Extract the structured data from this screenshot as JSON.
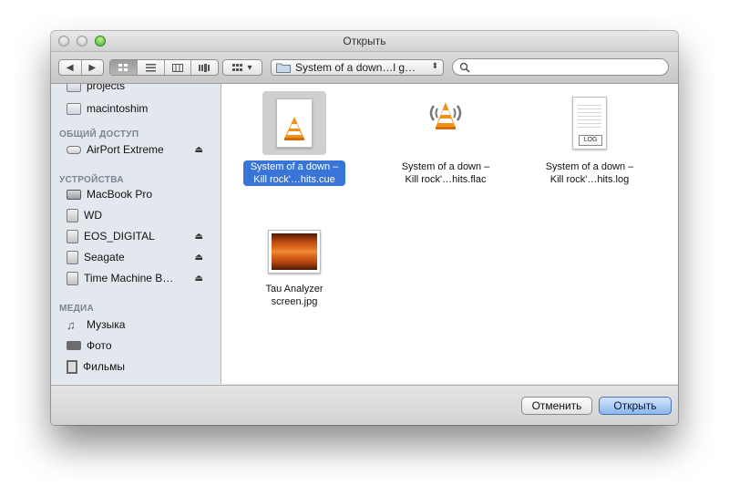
{
  "window": {
    "title": "Открыть"
  },
  "toolbar": {
    "back_glyph": "◀",
    "forward_glyph": "▶",
    "view_modes": [
      "icon-view",
      "list-view",
      "column-view",
      "coverflow-view"
    ],
    "arrange_glyph": "▾",
    "path_label": "System of a down…l g…",
    "search_placeholder": ""
  },
  "sidebar": {
    "partial_item": {
      "label": "projects",
      "icon": "folder-icon"
    },
    "items_top": [
      {
        "label": "macintoshim",
        "icon": "folder-icon"
      }
    ],
    "sections": [
      {
        "heading": "ОБЩИЙ ДОСТУП",
        "items": [
          {
            "label": "AirPort Extreme",
            "icon": "airport-icon",
            "eject": true
          }
        ]
      },
      {
        "heading": "УСТРОЙСТВА",
        "items": [
          {
            "label": "MacBook Pro",
            "icon": "laptop-icon",
            "eject": false
          },
          {
            "label": "WD",
            "icon": "drive-icon",
            "eject": false
          },
          {
            "label": "EOS_DIGITAL",
            "icon": "drive-icon",
            "eject": true
          },
          {
            "label": "Seagate",
            "icon": "drive-icon",
            "eject": true
          },
          {
            "label": "Time Machine B…",
            "icon": "time-machine-icon",
            "eject": true
          }
        ]
      },
      {
        "heading": "МЕДИА",
        "items": [
          {
            "label": "Музыка",
            "icon": "music-note-icon",
            "eject": false
          },
          {
            "label": "Фото",
            "icon": "camera-icon",
            "eject": false
          },
          {
            "label": "Фильмы",
            "icon": "film-icon",
            "eject": false
          }
        ]
      }
    ],
    "eject_glyph": "⏏"
  },
  "files": [
    {
      "line1": "System of a down –",
      "line2": "Kill rock'…hits.cue",
      "icon": "vlc-cue-icon",
      "selected": true
    },
    {
      "line1": "System of a down –",
      "line2": "Kill rock'…hits.flac",
      "icon": "vlc-audio-icon",
      "selected": false
    },
    {
      "line1": "System of a down –",
      "line2": "Kill rock'…hits.log",
      "icon": "log-document-icon",
      "badge": "LOG",
      "selected": false
    },
    {
      "line1": "Tau Analyzer",
      "line2": "screen.jpg",
      "icon": "image-thumbnail-icon",
      "selected": false
    }
  ],
  "buttons": {
    "cancel": "Отменить",
    "open": "Открыть"
  }
}
